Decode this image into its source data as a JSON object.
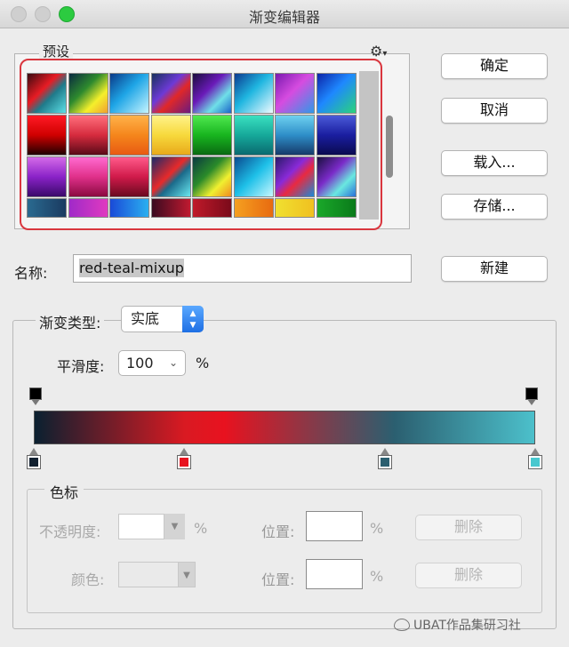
{
  "window": {
    "title": "渐变编辑器"
  },
  "presets": {
    "label": "预设",
    "menu_icon": "gear-icon",
    "swatches": [
      [
        "linear-gradient(135deg,#3a0a10 0%,#e81c24 40%,#1f7a8a 60%,#5de0e6 100%)",
        "linear-gradient(135deg,#0a2a40 0%,#2e8a2e 40%,#f4ef2b 70%,#f0a030 100%)",
        "linear-gradient(135deg,#0b3a88 0%,#1ea5e6 45%,#c6f5ff 100%)",
        "linear-gradient(135deg,#18315e 0%,#6d3ad6 40%,#e02828 60%,#6a1a80 100%)",
        "linear-gradient(135deg,#1a0e3e 0%,#6a1ab8 40%,#6fe0e8 70%,#1a64c8 100%)",
        "linear-gradient(135deg,#0c3a90 0%,#1fb6e0 45%,#f0fbff 100%)",
        "linear-gradient(135deg,#7a1ab0 0%,#d64ce0 45%,#2e9ae8 100%)",
        "linear-gradient(135deg,#0d24a8 0%,#1e88ff 45%,#2bd47a 100%)"
      ],
      [
        "linear-gradient(180deg,#ff1a25 0%,#d00000 50%,#200000 100%)",
        "linear-gradient(180deg,#ff6f7c 0%,#d62b3e 50%,#5a0a18 100%)",
        "linear-gradient(180deg,#ffb24a 0%,#f5861c 50%,#e85a12 100%)",
        "linear-gradient(180deg,#fff28a 0%,#f7d93c 50%,#e8a91a 100%)",
        "linear-gradient(180deg,#4fe84f 0%,#18b51f 50%,#0a6a12 100%)",
        "linear-gradient(180deg,#3ae0c0 0%,#16a99a 50%,#0a6a70 100%)",
        "linear-gradient(180deg,#6ed0f0 0%,#2e8ec8 50%,#163a6a 100%)",
        "linear-gradient(180deg,#4a5ad8 0%,#1a1ea0 50%,#0a0a50 100%)"
      ],
      [
        "linear-gradient(180deg,#d46ae8 0%,#8a22c8 50%,#3a0a6a 100%)",
        "linear-gradient(180deg,#ff6ad0 0%,#e0308a 50%,#8a0a40 100%)",
        "linear-gradient(180deg,#ff5a8a 0%,#d01a4a 50%,#6a0a20 100%)",
        "linear-gradient(135deg,#1a2a6a 0%,#e82a2a 45%,#1a6a8a 60%,#6ae8f0 100%)",
        "linear-gradient(135deg,#0a3a40 0%,#2a8a2a 40%,#f0f030 70%,#f08a20 100%)",
        "linear-gradient(135deg,#0a4a90 0%,#1ec0e8 50%,#c8f8ff 100%)",
        "linear-gradient(135deg,#2a1a6a 0%,#8a2ad8 40%,#e82a40 60%,#1a8ad8 100%)",
        "linear-gradient(135deg,#1a1040 0%,#7a2ac8 40%,#6ae8e0 70%,#2a70d8 100%)"
      ],
      [
        "linear-gradient(90deg,#2a6a90 0%,#1a3a60 100%)",
        "linear-gradient(90deg,#a02ac8 0%,#e03ac0 100%)",
        "linear-gradient(90deg,#1a4ad8 0%,#2ab0f0 100%)",
        "linear-gradient(90deg,#3a0a20 0%,#c01a30 100%)",
        "linear-gradient(90deg,#c01a2a 0%,#7a0a1a 100%)",
        "linear-gradient(90deg,#f5a020 0%,#e86a10 100%)",
        "linear-gradient(90deg,#f0e030 0%,#f0c020 100%)",
        "linear-gradient(90deg,#1aa82a 0%,#0a7a1a 100%)"
      ]
    ]
  },
  "buttons": {
    "ok": "确定",
    "cancel": "取消",
    "load": "载入...",
    "save": "存储...",
    "new": "新建"
  },
  "name": {
    "label": "名称:",
    "value": "red-teal-mixup"
  },
  "gradient": {
    "type_label": "渐变类型:",
    "type_value": "实底",
    "smoothness_label": "平滑度:",
    "smoothness_value": "100",
    "smoothness_unit": "%",
    "bar_colors": [
      "#0a2030",
      "#e8121f",
      "#2b5f70",
      "#4cc0cb"
    ],
    "opacity_stops": [
      0,
      100
    ],
    "color_stops": [
      {
        "location": 0,
        "color": "#112030"
      },
      {
        "location": 30,
        "color": "#e8121f"
      },
      {
        "location": 70,
        "color": "#2b5f70"
      },
      {
        "location": 100,
        "color": "#48c8cf"
      }
    ]
  },
  "stops": {
    "label": "色标",
    "opacity_label": "不透明度:",
    "opacity_unit": "%",
    "color_label": "颜色:",
    "location_label": "位置:",
    "location_unit": "%",
    "delete_label": "删除"
  },
  "watermark": {
    "text": "UBAT作品集研习社"
  }
}
